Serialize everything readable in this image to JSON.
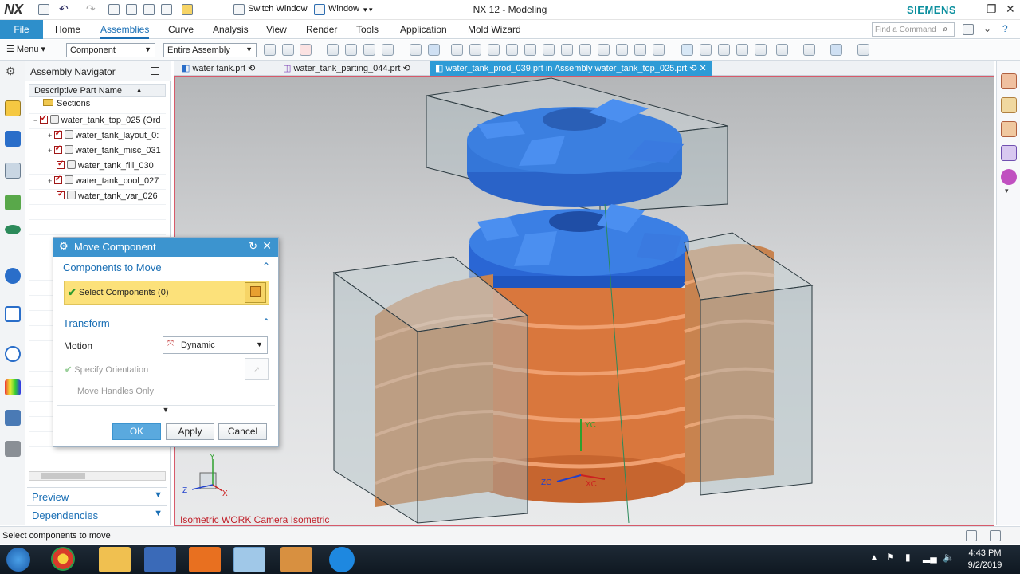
{
  "titlebar": {
    "logo": "NX",
    "switch_window": "Switch Window",
    "window_menu": "Window",
    "app_title": "NX 12 - Modeling",
    "brand": "SIEMENS",
    "min": "—",
    "restore": "❐",
    "close": "✕"
  },
  "ribbon": {
    "file": "File",
    "tabs": [
      "Home",
      "Assemblies",
      "Curve",
      "Analysis",
      "View",
      "Render",
      "Tools",
      "Application",
      "Mold Wizard"
    ],
    "active_tab": "Assemblies",
    "find_placeholder": "Find a Command"
  },
  "toolbar": {
    "menu": "Menu",
    "filter_combo": "Component",
    "scope_combo": "Entire Assembly"
  },
  "navigator": {
    "title": "Assembly Navigator",
    "column_header": "Descriptive Part Name",
    "sort_arrow": "▲",
    "rows": [
      {
        "label": "Sections",
        "indent": 0
      },
      {
        "label": "water_tank_top_025 (Ord",
        "indent": 0
      },
      {
        "label": "water_tank_layout_0:",
        "indent": 1
      },
      {
        "label": "water_tank_misc_031",
        "indent": 1
      },
      {
        "label": "water_tank_fill_030",
        "indent": 1
      },
      {
        "label": "water_tank_cool_027",
        "indent": 1
      },
      {
        "label": "water_tank_var_026",
        "indent": 1
      }
    ],
    "preview": "Preview",
    "dependencies": "Dependencies"
  },
  "doc_tabs": [
    {
      "label": "water tank.prt",
      "active": false
    },
    {
      "label": "water_tank_parting_044.prt",
      "active": false
    },
    {
      "label": "water_tank_prod_039.prt in Assembly water_tank_top_025.prt",
      "active": true
    }
  ],
  "viewport": {
    "label": "Isometric WORK Camera Isometric",
    "triad": {
      "y": "Y",
      "x": "X",
      "z": "Z"
    },
    "manip": {
      "xc": "XC",
      "yc": "YC",
      "zc": "ZC"
    }
  },
  "dialog": {
    "title": "Move Component",
    "section_components": "Components to Move",
    "select_components": "Select Components (0)",
    "section_transform": "Transform",
    "motion_label": "Motion",
    "motion_value": "Dynamic",
    "specify_orientation": "Specify Orientation",
    "move_handles_only": "Move Handles Only",
    "ok": "OK",
    "apply": "Apply",
    "cancel": "Cancel"
  },
  "status": {
    "message": "Select components to move"
  },
  "taskbar": {
    "time": "4:43 PM",
    "date": "9/2/2019"
  },
  "colors": {
    "accent": "#2e8fcb",
    "dialog_header": "#3c94cf",
    "selection_yellow": "#fce17a",
    "lid_blue": "#2f6fcf",
    "body_orange": "#d9773d",
    "mold_gray": "#a6b6bb"
  }
}
